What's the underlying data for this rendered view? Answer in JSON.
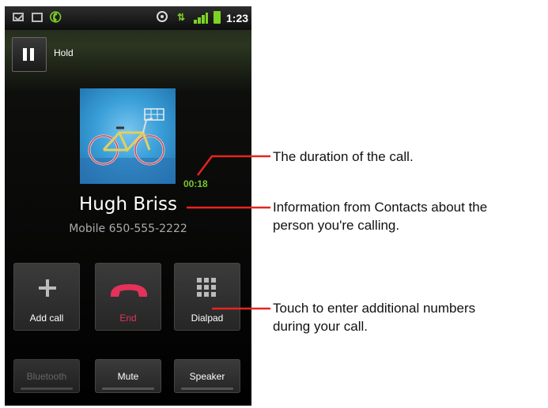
{
  "statusbar": {
    "time": "1:23"
  },
  "hold": {
    "label": "Hold"
  },
  "call": {
    "duration": "00:18",
    "name": "Hugh Briss",
    "number": "Mobile 650-555-2222"
  },
  "buttons": {
    "add_call": "Add call",
    "end": "End",
    "dialpad": "Dialpad",
    "bluetooth": "Bluetooth",
    "mute": "Mute",
    "speaker": "Speaker"
  },
  "callouts": {
    "duration": "The duration of the call.",
    "contact_line1": "Information from Contacts about the",
    "contact_line2": "person you're calling.",
    "dialpad_line1": "Touch to enter additional numbers",
    "dialpad_line2": "during your call."
  },
  "colors": {
    "accent_green": "#7bc52a",
    "end_red": "#e4325a",
    "callout_red": "#e8231f"
  }
}
